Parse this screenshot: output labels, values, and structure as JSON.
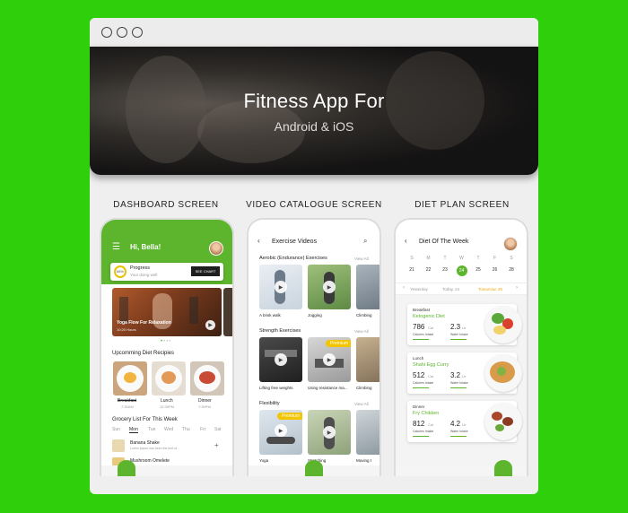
{
  "hero": {
    "title": "Fitness App For",
    "subtitle": "Android & iOS"
  },
  "screens": [
    {
      "label": "DASHBOARD SCREEN"
    },
    {
      "label": "VIDEO CATALOGUE SCREEN"
    },
    {
      "label": "DIET PLAN SCREEN"
    }
  ],
  "dashboard": {
    "greeting": "Hi, Bella!",
    "progress": {
      "title": "Progress",
      "subtitle": "Your doing well",
      "percent": "68%",
      "button": "SEE CHART"
    },
    "workout": {
      "title": "Yoga Flow For Relaxation",
      "duration": "10:20 Hours"
    },
    "recipes_heading": "Upcomming Diet Recipies",
    "recipes": [
      {
        "meal": "Breakfast",
        "time": "7:30AM"
      },
      {
        "meal": "Lunch",
        "time": "12:30PM"
      },
      {
        "meal": "Dinner",
        "time": "7:30PM"
      }
    ],
    "grocery_heading": "Grocery List For This Week",
    "days": [
      "Sun",
      "Mon",
      "Tue",
      "Wed",
      "Thu",
      "Fri",
      "Sat"
    ],
    "selected_day": "Mon",
    "grocery_items": [
      {
        "name": "Banana Shake",
        "desc": "Lorem ipsum has been the text of..."
      },
      {
        "name": "Mushroom Omelete",
        "desc": ""
      }
    ]
  },
  "videos": {
    "title": "Exercise Videos",
    "view_all": "View All",
    "sections": [
      {
        "heading": "Aerobic (Endurance) Exercises",
        "items": [
          "A brisk walk",
          "Jogging",
          "Climbing"
        ]
      },
      {
        "heading": "Strength Exercises",
        "items": [
          "Lifting free weights",
          "Using resistance ma...",
          "Climbing"
        ],
        "premium_index": 1
      },
      {
        "heading": "Flexibility",
        "items": [
          "Yoga",
          "Stretching",
          "Moving t"
        ],
        "premium_index": 0
      }
    ],
    "premium_label": "Premium"
  },
  "diet": {
    "title": "Diet Of The Week",
    "weekdays": [
      "S",
      "M",
      "T",
      "W",
      "T",
      "F",
      "S"
    ],
    "dates": [
      "21",
      "22",
      "23",
      "24",
      "25",
      "26",
      "28"
    ],
    "selected_date": "24",
    "day_tabs": [
      "Yesterday",
      "Today, 24",
      "Tomorrow, 25"
    ],
    "active_tab": "Tomorrow, 25",
    "meals": [
      {
        "meal": "Breakfast",
        "name": "Ketogenic Diet",
        "cal": "786",
        "water": "2.3",
        "cal_unit": "Cal",
        "water_unit": "Ltr",
        "cal_label": "Calories Intake",
        "water_label": "Water Intake"
      },
      {
        "meal": "Lunch",
        "name": "Shahi Egg Curry",
        "cal": "512",
        "water": "3.2",
        "cal_unit": "Cal",
        "water_unit": "Ltr",
        "cal_label": "Calories Intake",
        "water_label": "Water Intake"
      },
      {
        "meal": "Dinner",
        "name": "Fry Chikken",
        "cal": "812",
        "water": "4.2",
        "cal_unit": "Cal",
        "water_unit": "Ltr",
        "cal_label": "Calories Intake",
        "water_label": "Water Intake"
      }
    ]
  },
  "colors": {
    "brand_green": "#5cb52c",
    "background_green": "#2fcf0c",
    "premium_yellow": "#f2c500"
  },
  "icons": [
    "menu-icon",
    "back-icon",
    "search-icon",
    "play-icon",
    "plus-icon",
    "chevron-left-icon",
    "chevron-right-icon"
  ]
}
